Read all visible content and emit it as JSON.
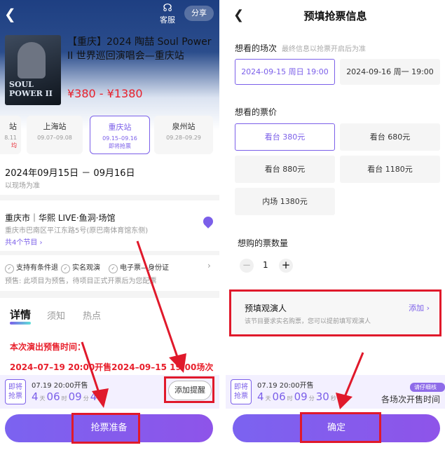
{
  "left": {
    "nav": {
      "customer_service": "客服",
      "share": "分享"
    },
    "poster_text": "SOUL\nPOWER II",
    "event": {
      "title": "【重庆】2024 陶喆 Soul Power II 世界巡回演唱会—重庆站",
      "price": "¥380 - ¥1380"
    },
    "stations": [
      {
        "name": "站",
        "dates": "8.11",
        "badge": "均"
      },
      {
        "name": "上海站",
        "dates": "09.07–09.08",
        "badge": ""
      },
      {
        "name": "重庆站",
        "dates": "09.15–09.16",
        "badge": "即将抢票"
      },
      {
        "name": "泉州站",
        "dates": "09.28–09.29",
        "badge": ""
      }
    ],
    "date_range": "2024年09月15日 － 09月16日",
    "date_note": "以现场为准",
    "venue": {
      "name": "重庆市｜华熙 LIVE·鱼洞·场馆",
      "address": "重庆市巴南区平江东路5号(原巴南体育馆东侧)",
      "programs": "共4个节目"
    },
    "features": [
      "支持有条件退",
      "实名观演",
      "电子票—身份证"
    ],
    "presale_note": "预售: 此项目为预售，待项目正式开票后为您配票",
    "tabs": [
      "详情",
      "须知",
      "热点"
    ],
    "notice_title": "本次演出预售时间：",
    "notice_line": "2024–07–19 20:00开售2024–09–15 19:00场次",
    "countdown": {
      "badge": "即将抢票",
      "open_time": "07.19 20:00开售",
      "days": "4",
      "hours": "06",
      "minutes": "09",
      "seconds": "4",
      "unit_day": "天",
      "unit_hour": "时",
      "unit_min": "分"
    },
    "remind_label": "添加提醒",
    "main_button": "抢票准备"
  },
  "right": {
    "title": "预填抢票信息",
    "session_label": "想看的场次",
    "session_hint": "最终信息以抢票开启后为准",
    "sessions": [
      "2024-09-15 周日 19:00",
      "2024-09-16 周一 19:00"
    ],
    "price_label": "想看的票价",
    "prices": [
      "看台 380元",
      "看台 680元",
      "看台 880元",
      "看台 1180元",
      "内场 1380元"
    ],
    "qty_label": "想购的票数量",
    "qty": "1",
    "audience": {
      "title": "预填观演人",
      "desc": "该节目要求实名购票，您可以提前填写观演人",
      "add": "添加"
    },
    "countdown": {
      "badge": "即将抢票",
      "open_time": "07.19 20:00开售",
      "days": "4",
      "hours": "06",
      "minutes": "09",
      "seconds": "30",
      "unit_day": "天",
      "unit_hour": "时",
      "unit_min": "分",
      "unit_sec": "秒",
      "tag": "请仔细核对",
      "all_time": "各场次开售时间"
    },
    "confirm": "确定"
  },
  "accent_color": "#7b5fe9",
  "highlight_color": "#e0192b"
}
